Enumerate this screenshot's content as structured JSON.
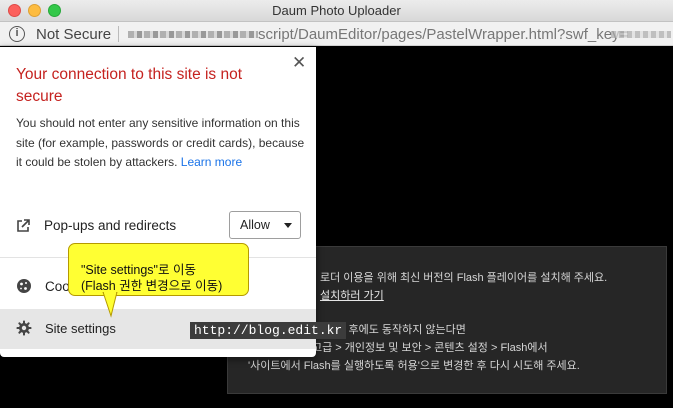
{
  "window": {
    "title": "Daum Photo Uploader"
  },
  "urlbar": {
    "security_label": "Not Secure",
    "url_visible": "script/DaumEditor/pages/PastelWrapper.html?swf_key="
  },
  "popup": {
    "heading": "Your connection to this site is not secure",
    "description": "You should not enter any sensitive information on this site (for example, passwords or credit cards), because it could be stolen by attackers.",
    "learn_more": "Learn more",
    "popups_label": "Pop-ups and redirects",
    "popups_value": "Allow",
    "cookies_label": "Coo",
    "site_settings_label": "Site settings"
  },
  "flash": {
    "line1": "로더 이용을 위해 최신 버전의 Flash 플레이어를 설치해 주세요.",
    "link": "설치하러 가기",
    "line3": "서 설치 후에도 동작하지 않는다면",
    "line4": "고급 > 개인정보 및 보안 > 콘텐츠 설정 > Flash에서",
    "line5": "'사이트에서 Flash를 실행하도록 허용'으로 변경한 후 다시 시도해 주세요."
  },
  "annotation": {
    "line1": "\"Site settings\"로 이동",
    "line2": "(Flash 권한 변경으로 이동)"
  },
  "watermark": "http://blog.edit.kr",
  "icons": {
    "info": "info-icon",
    "close": "close-icon",
    "popups": "external-link-icon",
    "cookies": "cookie-icon",
    "site_settings": "gear-icon"
  },
  "colors": {
    "heading_red": "#c5221f",
    "link_blue": "#1a73e8",
    "callout_yellow": "#ffff33"
  }
}
